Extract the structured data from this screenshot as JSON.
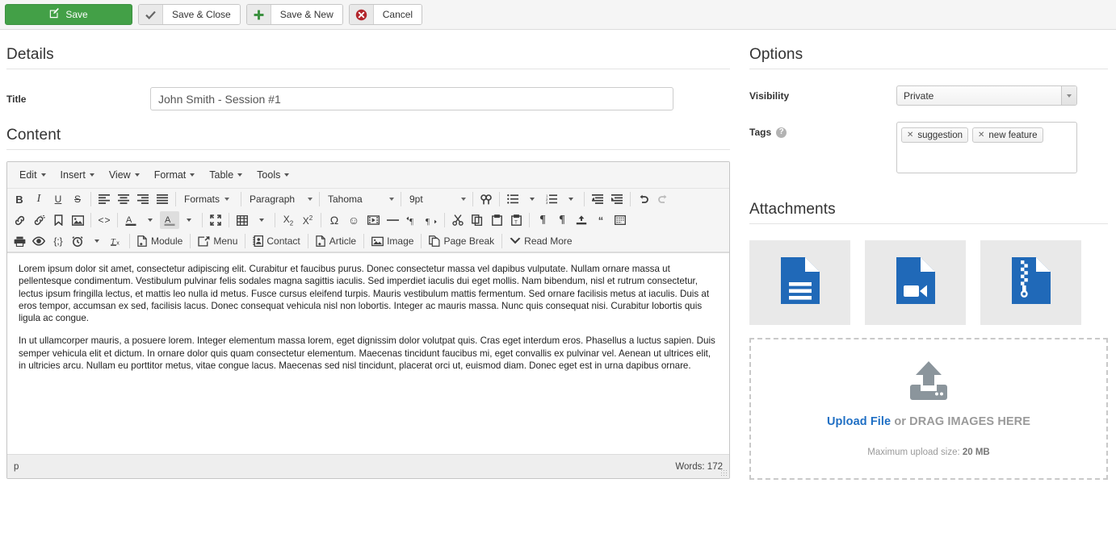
{
  "toolbar": {
    "save": {
      "label": "Save",
      "icon": "pencil-square-icon"
    },
    "save_close": {
      "label": "Save & Close",
      "icon": "check-icon"
    },
    "save_new": {
      "label": "Save & New",
      "icon": "plus-icon"
    },
    "cancel": {
      "label": "Cancel",
      "icon": "circle-x-icon"
    }
  },
  "details": {
    "heading": "Details",
    "title_label": "Title",
    "title_value": "John Smith - Session #1"
  },
  "content": {
    "heading": "Content",
    "menubar": [
      "Edit",
      "Insert",
      "View",
      "Format",
      "Table",
      "Tools"
    ],
    "selects": {
      "formats": "Formats",
      "paragraph": "Paragraph",
      "font": "Tahoma",
      "fontsize": "9pt"
    },
    "plugin_buttons": [
      {
        "label": "Module",
        "icon": "page-plus-icon"
      },
      {
        "label": "Menu",
        "icon": "share-arrow-icon"
      },
      {
        "label": "Contact",
        "icon": "contact-card-icon"
      },
      {
        "label": "Article",
        "icon": "page-plus-icon"
      },
      {
        "label": "Image",
        "icon": "image-icon"
      },
      {
        "label": "Page Break",
        "icon": "page-break-icon"
      },
      {
        "label": "Read More",
        "icon": "chevron-down-bold-icon"
      }
    ],
    "body": [
      "Lorem ipsum dolor sit amet, consectetur adipiscing elit. Curabitur et faucibus purus. Donec consectetur massa vel dapibus vulputate. Nullam ornare massa ut pellentesque condimentum. Vestibulum pulvinar felis sodales magna sagittis iaculis. Sed imperdiet iaculis dui eget mollis. Nam bibendum, nisl et rutrum consectetur, lectus ipsum fringilla lectus, et mattis leo nulla id metus. Fusce cursus eleifend turpis. Mauris vestibulum mattis fermentum. Sed ornare facilisis metus at iaculis. Duis at eros tempor, accumsan ex sed, facilisis lacus. Donec consequat vehicula nisl non lobortis. Integer ac mauris massa. Nunc quis consequat nisi. Curabitur lobortis quis ligula ac congue.",
      "In ut ullamcorper mauris, a posuere lorem. Integer elementum massa lorem, eget dignissim dolor volutpat quis. Cras eget interdum eros. Phasellus a luctus sapien. Duis semper vehicula elit et dictum. In ornare dolor quis quam consectetur elementum. Maecenas tincidunt faucibus mi, eget convallis ex pulvinar vel. Aenean ut ultrices elit, in ultricies arcu. Nullam eu porttitor metus, vitae congue lacus. Maecenas sed nisl tincidunt, placerat orci ut, euismod diam. Donec eget est in urna dapibus ornare."
    ],
    "statusbar": {
      "path": "p",
      "words": "Words: 172"
    }
  },
  "options": {
    "heading": "Options",
    "visibility_label": "Visibility",
    "visibility_value": "Private",
    "tags_label": "Tags",
    "tags_help_icon": "question-circle-icon",
    "tags": [
      "suggestion",
      "new feature"
    ]
  },
  "attachments": {
    "heading": "Attachments",
    "items": [
      {
        "icon": "document-file-icon",
        "color": "#2069b8"
      },
      {
        "icon": "video-file-icon",
        "color": "#2069b8"
      },
      {
        "icon": "zip-file-icon",
        "color": "#2069b8"
      }
    ],
    "dropzone": {
      "icon": "upload-icon",
      "link_text": "Upload File",
      "rest_text": " or DRAG IMAGES HERE",
      "max_prefix": "Maximum upload size: ",
      "max_value": "20 MB"
    }
  },
  "colors": {
    "save_green": "#43a047",
    "cancel_red": "#b3272d",
    "link_blue": "#1f6fc4",
    "file_blue": "#2069b8"
  }
}
